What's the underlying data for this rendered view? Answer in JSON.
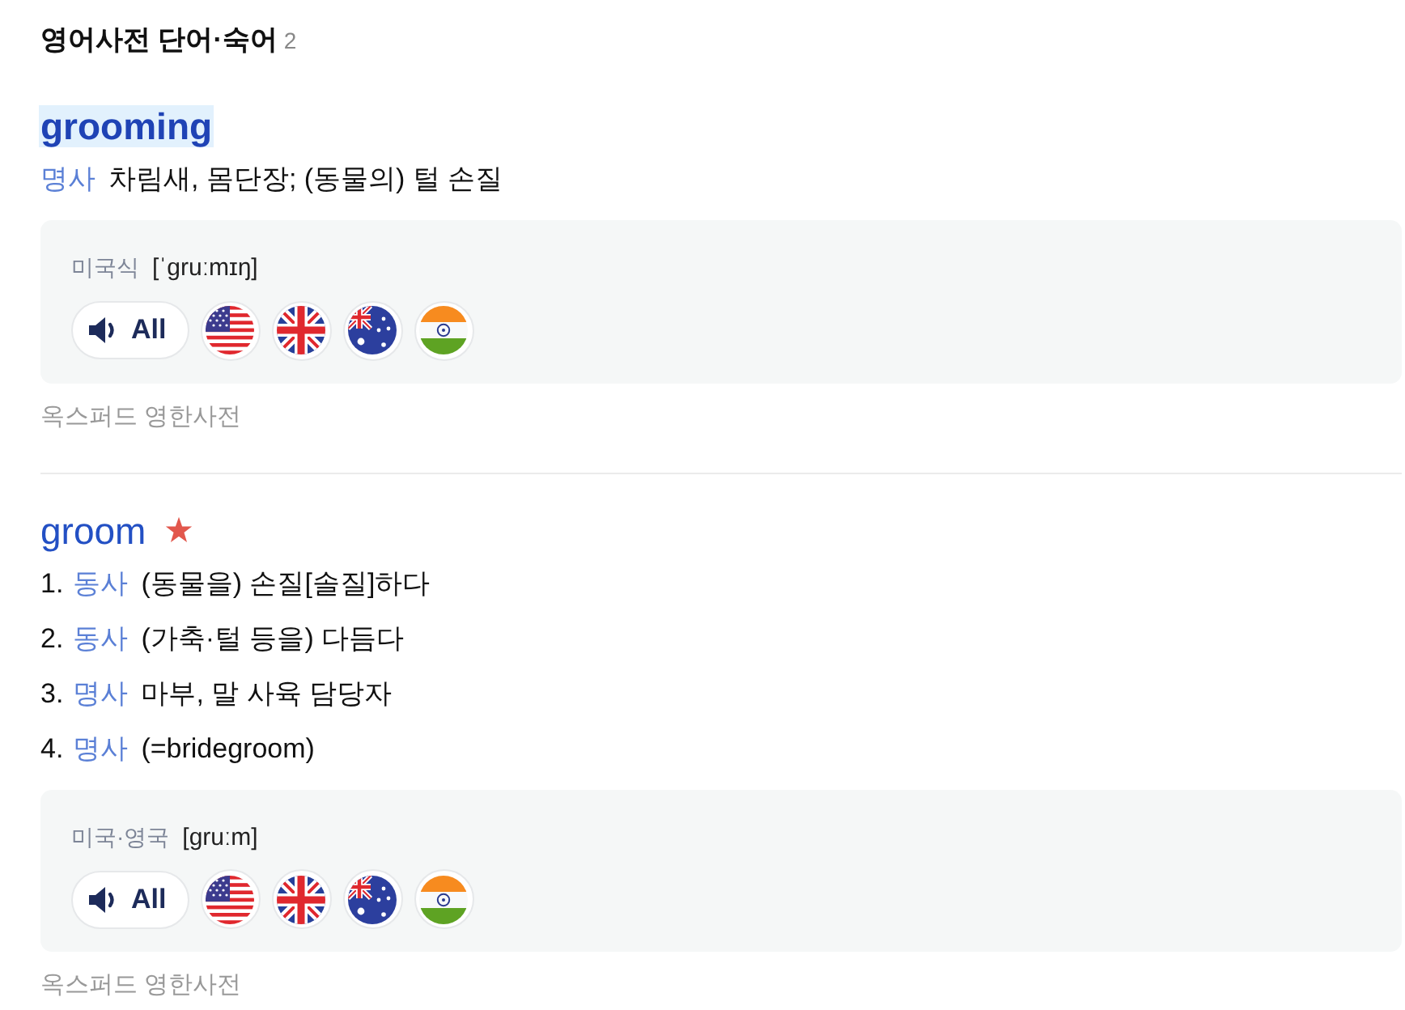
{
  "header": {
    "title": "영어사전 단어·숙어",
    "count": "2"
  },
  "entries": [
    {
      "word": "grooming",
      "highlighted": true,
      "starred": false,
      "senses": [
        {
          "pos": "명사",
          "definition": "차림새, 몸단장; (동물의) 털 손질"
        }
      ],
      "pronunciation": {
        "label": "미국식",
        "phonetic": "[ˈgruːmɪŋ]",
        "play_label": "All"
      },
      "source": "옥스퍼드 영한사전"
    },
    {
      "word": "groom",
      "highlighted": false,
      "starred": true,
      "senses": [
        {
          "number": "1.",
          "pos": "동사",
          "definition": "(동물을) 손질[솔질]하다"
        },
        {
          "number": "2.",
          "pos": "동사",
          "definition": "(가축·털 등을) 다듬다"
        },
        {
          "number": "3.",
          "pos": "명사",
          "definition": "마부, 말 사육 담당자"
        },
        {
          "number": "4.",
          "pos": "명사",
          "definition": "(=bridegroom)"
        }
      ],
      "pronunciation": {
        "label": "미국·영국",
        "phonetic": "[gruːm]",
        "play_label": "All"
      },
      "source": "옥스퍼드 영한사전"
    }
  ]
}
